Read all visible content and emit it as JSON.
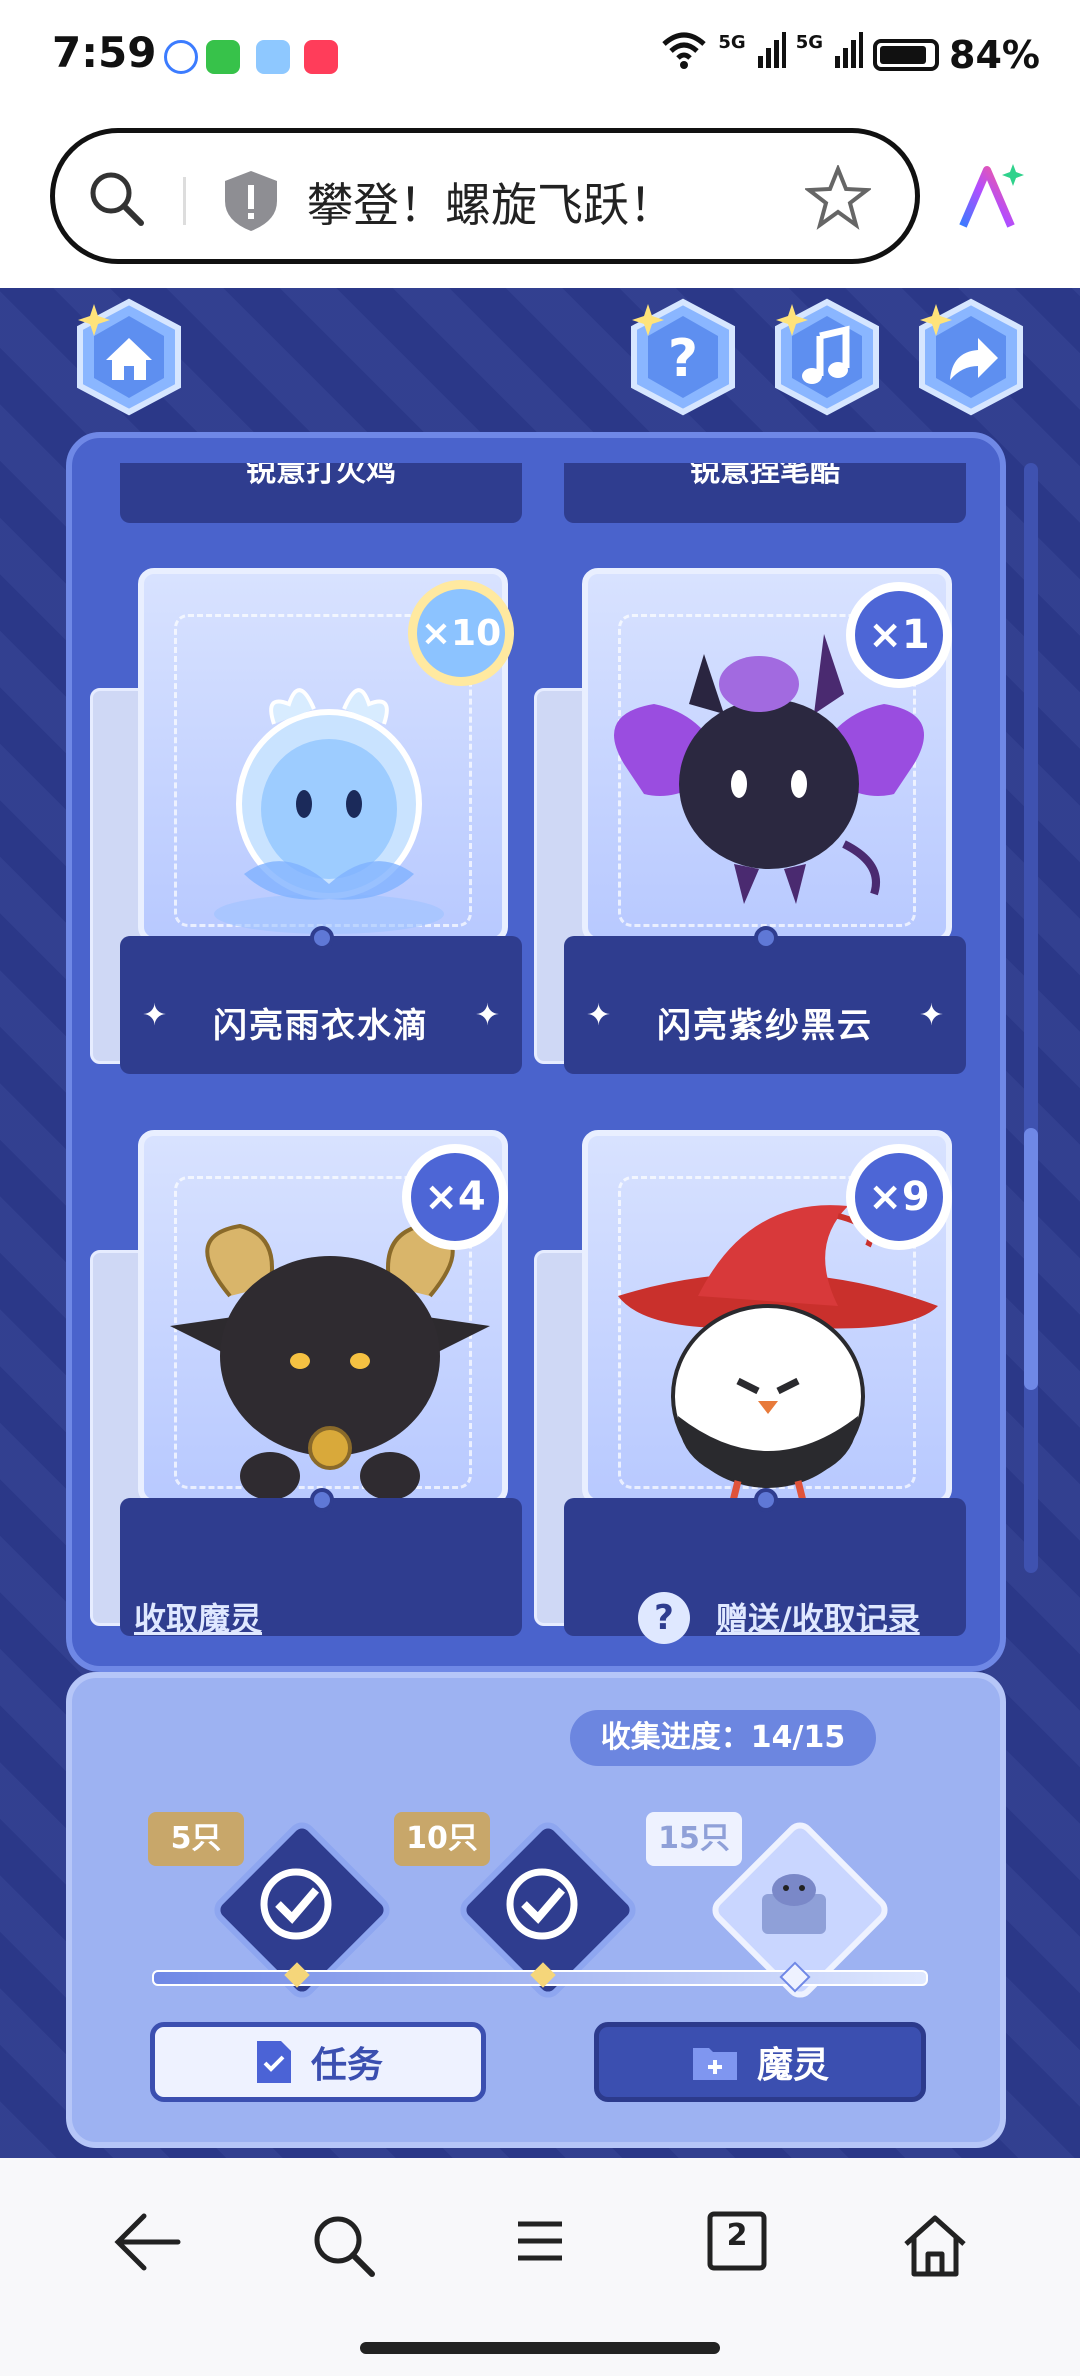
{
  "status_bar": {
    "time": "7:59",
    "signal1": "5G",
    "signal2": "5G",
    "battery": "84%"
  },
  "address_bar": {
    "title": "攀登！螺旋飞跃！"
  },
  "game": {
    "top_buttons": [
      "home-icon",
      "help-icon",
      "music-icon",
      "share-icon"
    ],
    "top_row_labels": [
      "锐意打火鸡",
      "锐意捏笔酷"
    ],
    "cards": [
      {
        "name": "闪亮雨衣水滴",
        "count": "×10"
      },
      {
        "name": "闪亮紫纱黑云",
        "count": "×1"
      },
      {
        "name": "",
        "count": "×4"
      },
      {
        "name": "",
        "count": "×9"
      }
    ],
    "links": {
      "collect": "收取魔灵",
      "help": "?",
      "records": "赠送/收取记录"
    },
    "progress": {
      "label": "收集进度：",
      "value": "14/15"
    },
    "milestones": [
      {
        "tag": "5只",
        "done": true
      },
      {
        "tag": "10只",
        "done": true
      },
      {
        "tag": "15只",
        "done": false
      }
    ],
    "buttons": {
      "task": "任务",
      "spirit": "魔灵"
    }
  },
  "nav": {
    "tabs_count": "2"
  }
}
